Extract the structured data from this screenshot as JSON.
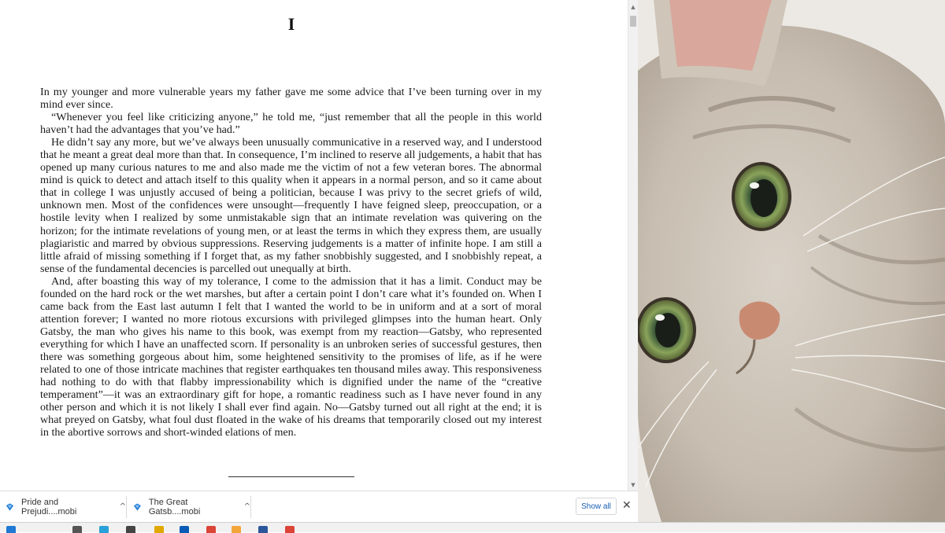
{
  "book": {
    "chapter": "I",
    "paragraphs": [
      "In my younger and more vulnerable years my father gave me some advice that I’ve been turning over in my mind ever since.",
      "“Whenever you feel like criticizing anyone,” he told me, “just remember that all the people in this world haven’t had the advantages that you’ve had.”",
      "He didn’t say any more, but we’ve always been unusually communicative in a reserved way, and I understood that he meant a great deal more than that. In consequence, I’m inclined to reserve all judgements, a habit that has opened up many curious natures to me and also made me the victim of not a few veteran bores. The abnormal mind is quick to detect and attach itself to this quality when it appears in a normal person, and so it came about that in college I was unjustly accused of being a politician, because I was privy to the secret griefs of wild, unknown men. Most of the confidences were unsought—frequently I have feigned sleep, preoccupation, or a hostile levity when I realized by some unmistakable sign that an intimate revelation was quivering on the horizon; for the intimate revelations of young men, or at least the terms in which they express them, are usually plagiaristic and marred by obvious suppressions. Reserving judgements is a matter of infinite hope. I am still a little afraid of missing something if I forget that, as my father snobbishly suggested, and I snobbishly repeat, a sense of the fundamental decencies is parcelled out unequally at birth.",
      "And, after boasting this way of my tolerance, I come to the admission that it has a limit. Conduct may be founded on the hard rock or the wet marshes, but after a certain point I don’t care what it’s founded on. When I came back from the East last autumn I felt that I wanted the world to be in uniform and at a sort of moral attention forever; I wanted no more riotous excursions with privileged glimpses into the human heart. Only Gatsby, the man who gives his name to this book, was exempt from my reaction—Gatsby, who represented everything for which I have an unaffected scorn. If personality is an unbroken series of successful gestures, then there was something gorgeous about him, some heightened sensitivity to the promises of life, as if he were related to one of those intricate machines that register earthquakes ten thousand miles away. This responsiveness had nothing to do with that flabby impressionability which is dignified under the name of the “creative temperament”—it was an extraordinary gift for hope, a romantic readiness such as I have never found in any other person and which it is not likely I shall ever find again. No—Gatsby turned out all right at the end; it is what preyed on Gatsby, what foul dust floated in the wake of his dreams that temporarily closed out my interest in the abortive sorrows and short-winded elations of men."
    ]
  },
  "downloads": {
    "items": [
      {
        "name": "Pride and Prejudi....mobi",
        "icon": "mobi-file-icon"
      },
      {
        "name": "The Great Gatsb....mobi",
        "icon": "mobi-file-icon"
      }
    ],
    "show_all": "Show all"
  },
  "colors": {
    "link_blue": "#1a5fb4",
    "icon_blue": "#1e78d4"
  }
}
